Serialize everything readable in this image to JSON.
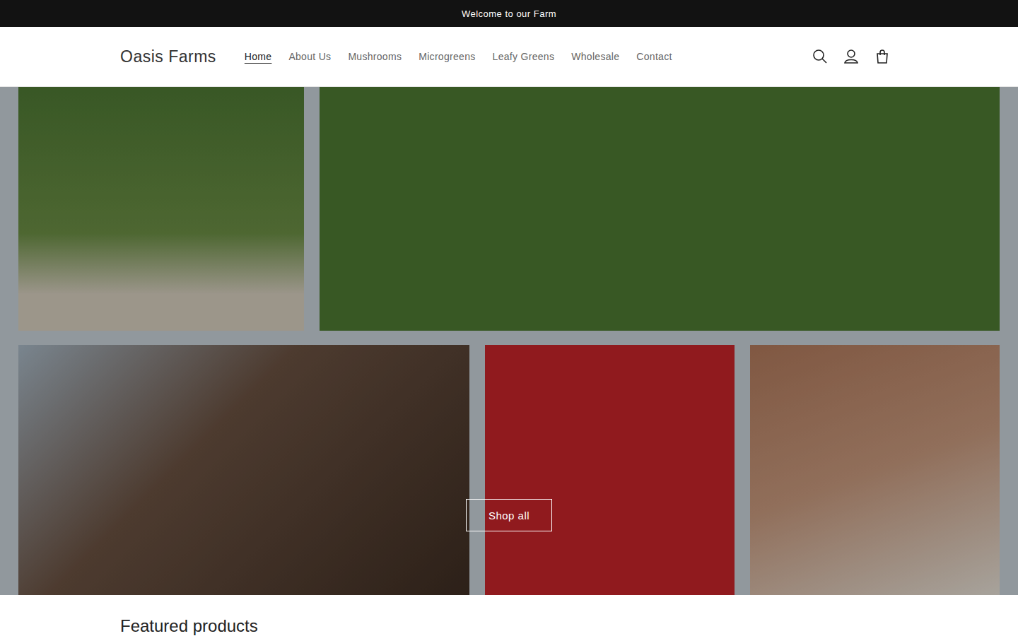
{
  "announcement": "Welcome to our Farm",
  "header": {
    "logo": "Oasis Farms",
    "nav": [
      {
        "label": "Home",
        "selected": true
      },
      {
        "label": "About Us",
        "selected": false
      },
      {
        "label": "Mushrooms",
        "selected": false
      },
      {
        "label": "Microgreens",
        "selected": false
      },
      {
        "label": "Leafy Greens",
        "selected": false
      },
      {
        "label": "Wholesale",
        "selected": false
      },
      {
        "label": "Contact",
        "selected": false
      }
    ]
  },
  "hero": {
    "button": "Shop all"
  },
  "featured": {
    "heading": "Featured products"
  }
}
